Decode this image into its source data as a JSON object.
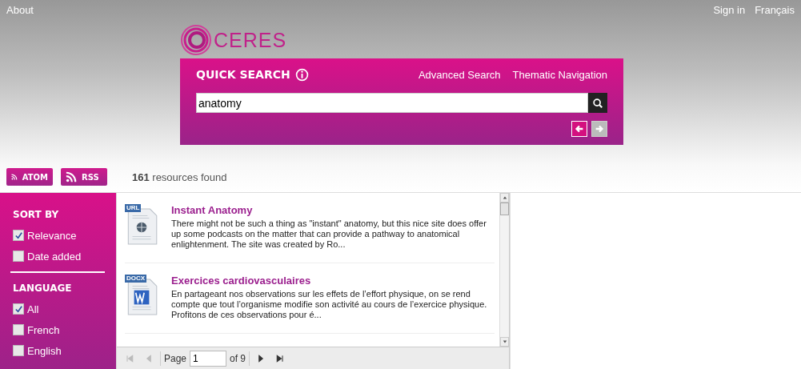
{
  "header": {
    "left_links": [
      "About"
    ],
    "right_links": [
      "Sign in",
      "Français"
    ]
  },
  "logo": {
    "text": "CERES"
  },
  "quick_search": {
    "title": "QUICK SEARCH",
    "links": [
      "Advanced Search",
      "Thematic Navigation"
    ],
    "query": "anatomy",
    "nav": [
      {
        "kind": "back",
        "disabled": false
      },
      {
        "kind": "forward",
        "disabled": true
      }
    ]
  },
  "feeds": [
    "ATOM",
    "RSS"
  ],
  "result_count": "**161** resources found",
  "sidebar": [
    {
      "title": "SORT BY",
      "options": [
        {
          "label": "Relevance",
          "checked": true
        },
        {
          "label": "Date added",
          "checked": false
        }
      ]
    },
    {
      "title": "LANGUAGE",
      "options": [
        {
          "label": "All",
          "checked": true
        },
        {
          "label": "French",
          "checked": false
        },
        {
          "label": "English",
          "checked": false
        }
      ]
    }
  ],
  "results": [
    {
      "kind": "url",
      "badge": "URL",
      "title": "Instant Anatomy",
      "snippet": "There might not be such a thing as \"instant\" anatomy, but this nice site does offer up some podcasts on the matter that can provide a pathway to anatomical enlightenment. The site was created by Ro..."
    },
    {
      "kind": "docx",
      "badge": "DOCX",
      "title": "Exercices cardiovasculaires",
      "snippet": "En partageant nos observations sur les effets de l’effort physique, on se rend compte que tout l’organisme modifie son activité au cours de l’exercice physique. Profitons de ces observations pour é..."
    }
  ],
  "pager": {
    "label": "Page",
    "page": "1",
    "total": "of 9",
    "buttons": [
      {
        "kind": "first",
        "disabled": true
      },
      {
        "kind": "prev",
        "disabled": true
      },
      {
        "kind": "next",
        "disabled": false
      },
      {
        "kind": "last",
        "disabled": false
      }
    ]
  }
}
